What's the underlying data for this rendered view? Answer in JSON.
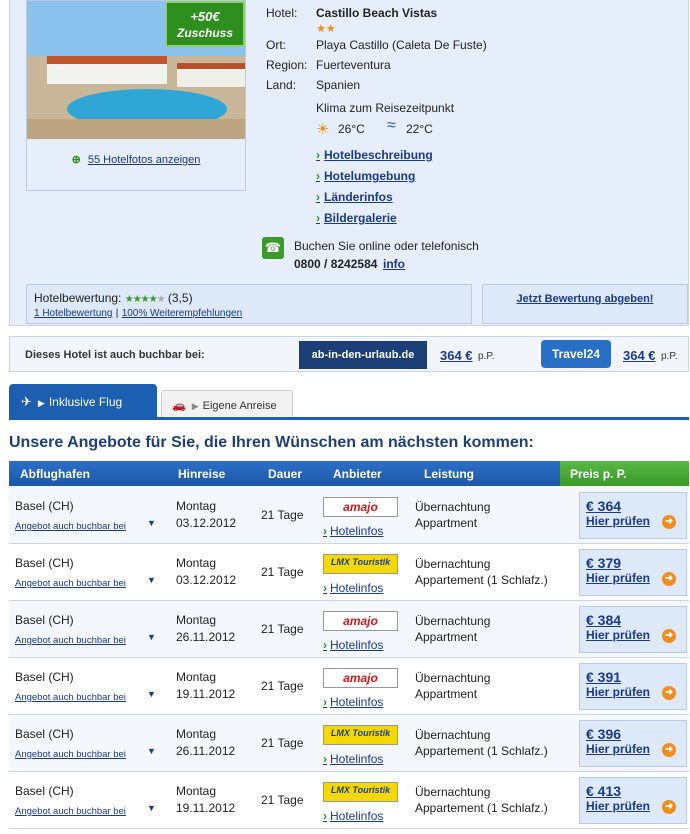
{
  "hotel": {
    "badge_line1": "+50€",
    "badge_line2": "Zuschuss",
    "photos_link": "55 Hotelfotos anzeigen",
    "labels": {
      "hotel": "Hotel:",
      "ort": "Ort:",
      "region": "Region:",
      "land": "Land:"
    },
    "name": "Castillo Beach Vistas",
    "stars": "★★",
    "ort": "Playa Castillo (Caleta De Fuste)",
    "region": "Fuerteventura",
    "land": "Spanien",
    "klima_title": "Klima zum Reisezeitpunkt",
    "air_temp": "26°C",
    "water_temp": "22°C",
    "links": [
      "Hotelbeschreibung",
      "Hotelumgebung",
      "Länderinfos",
      "Bildergalerie"
    ],
    "booking_text": "Buchen Sie online oder telefonisch",
    "phone": "0800 / 8242584",
    "info_link": "info"
  },
  "rating": {
    "label": "Hotelbewertung:",
    "value": "(3,5)",
    "stars_filled": 4,
    "count_link": "1 Hotelbewertung",
    "sep": "|",
    "recommend_link": "100% Weiterempfehlungen",
    "review_button": "Jetzt Bewertung abgeben!"
  },
  "partner": {
    "label": "Dieses Hotel ist auch buchbar bei:",
    "p1_logo": "ab-in-den-urlaub.de",
    "p1_price": "364 €",
    "p1_pp": "p.P.",
    "p2_logo": "Travel24",
    "p2_price": "364 €",
    "p2_pp": "p.P."
  },
  "tabs": {
    "tab1": "Inklusive Flug",
    "tab2": "Eigene Anreise"
  },
  "offers_title": "Unsere Angebote für Sie, die Ihren Wünschen am nächsten kommen:",
  "table": {
    "headers": [
      "Abflughafen",
      "Hinreise",
      "Dauer",
      "Anbieter",
      "Leistung",
      "Preis p. P."
    ],
    "rows": [
      {
        "airport": "Basel (CH)",
        "alt": "Angebot auch buchbar bei",
        "day": "Montag",
        "date": "03.12.2012",
        "duration": "21 Tage",
        "provider": "amajo",
        "hotelinfo": "Hotelinfos",
        "service1": "Übernachtung",
        "service2": "Appartment",
        "price": "€ 364",
        "check": "Hier prüfen"
      },
      {
        "airport": "Basel (CH)",
        "alt": "Angebot auch buchbar bei",
        "day": "Montag",
        "date": "03.12.2012",
        "duration": "21 Tage",
        "provider": "LMX Touristik",
        "hotelinfo": "Hotelinfos",
        "service1": "Übernachtung",
        "service2": "Appartement (1 Schlafz.)",
        "price": "€ 379",
        "check": "Hier prüfen"
      },
      {
        "airport": "Basel (CH)",
        "alt": "Angebot auch buchbar bei",
        "day": "Montag",
        "date": "26.11.2012",
        "duration": "21 Tage",
        "provider": "amajo",
        "hotelinfo": "Hotelinfos",
        "service1": "Übernachtung",
        "service2": "Appartment",
        "price": "€ 384",
        "check": "Hier prüfen"
      },
      {
        "airport": "Basel (CH)",
        "alt": "Angebot auch buchbar bei",
        "day": "Montag",
        "date": "19.11.2012",
        "duration": "21 Tage",
        "provider": "amajo",
        "hotelinfo": "Hotelinfos",
        "service1": "Übernachtung",
        "service2": "Appartment",
        "price": "€ 391",
        "check": "Hier prüfen"
      },
      {
        "airport": "Basel (CH)",
        "alt": "Angebot auch buchbar bei",
        "day": "Montag",
        "date": "26.11.2012",
        "duration": "21 Tage",
        "provider": "LMX Touristik",
        "hotelinfo": "Hotelinfos",
        "service1": "Übernachtung",
        "service2": "Appartement (1 Schlafz.)",
        "price": "€ 396",
        "check": "Hier prüfen"
      },
      {
        "airport": "Basel (CH)",
        "alt": "Angebot auch buchbar bei",
        "day": "Montag",
        "date": "19.11.2012",
        "duration": "21 Tage",
        "provider": "LMX Touristik",
        "hotelinfo": "Hotelinfos",
        "service1": "Übernachtung",
        "service2": "Appartement (1 Schlafz.)",
        "price": "€ 413",
        "check": "Hier prüfen"
      }
    ]
  },
  "colors": {
    "link": "#1a3a8a",
    "accent": "#1c5fb0",
    "green": "#3a9a2a",
    "orange": "#f28c1e",
    "panel": "#e6eefb"
  }
}
